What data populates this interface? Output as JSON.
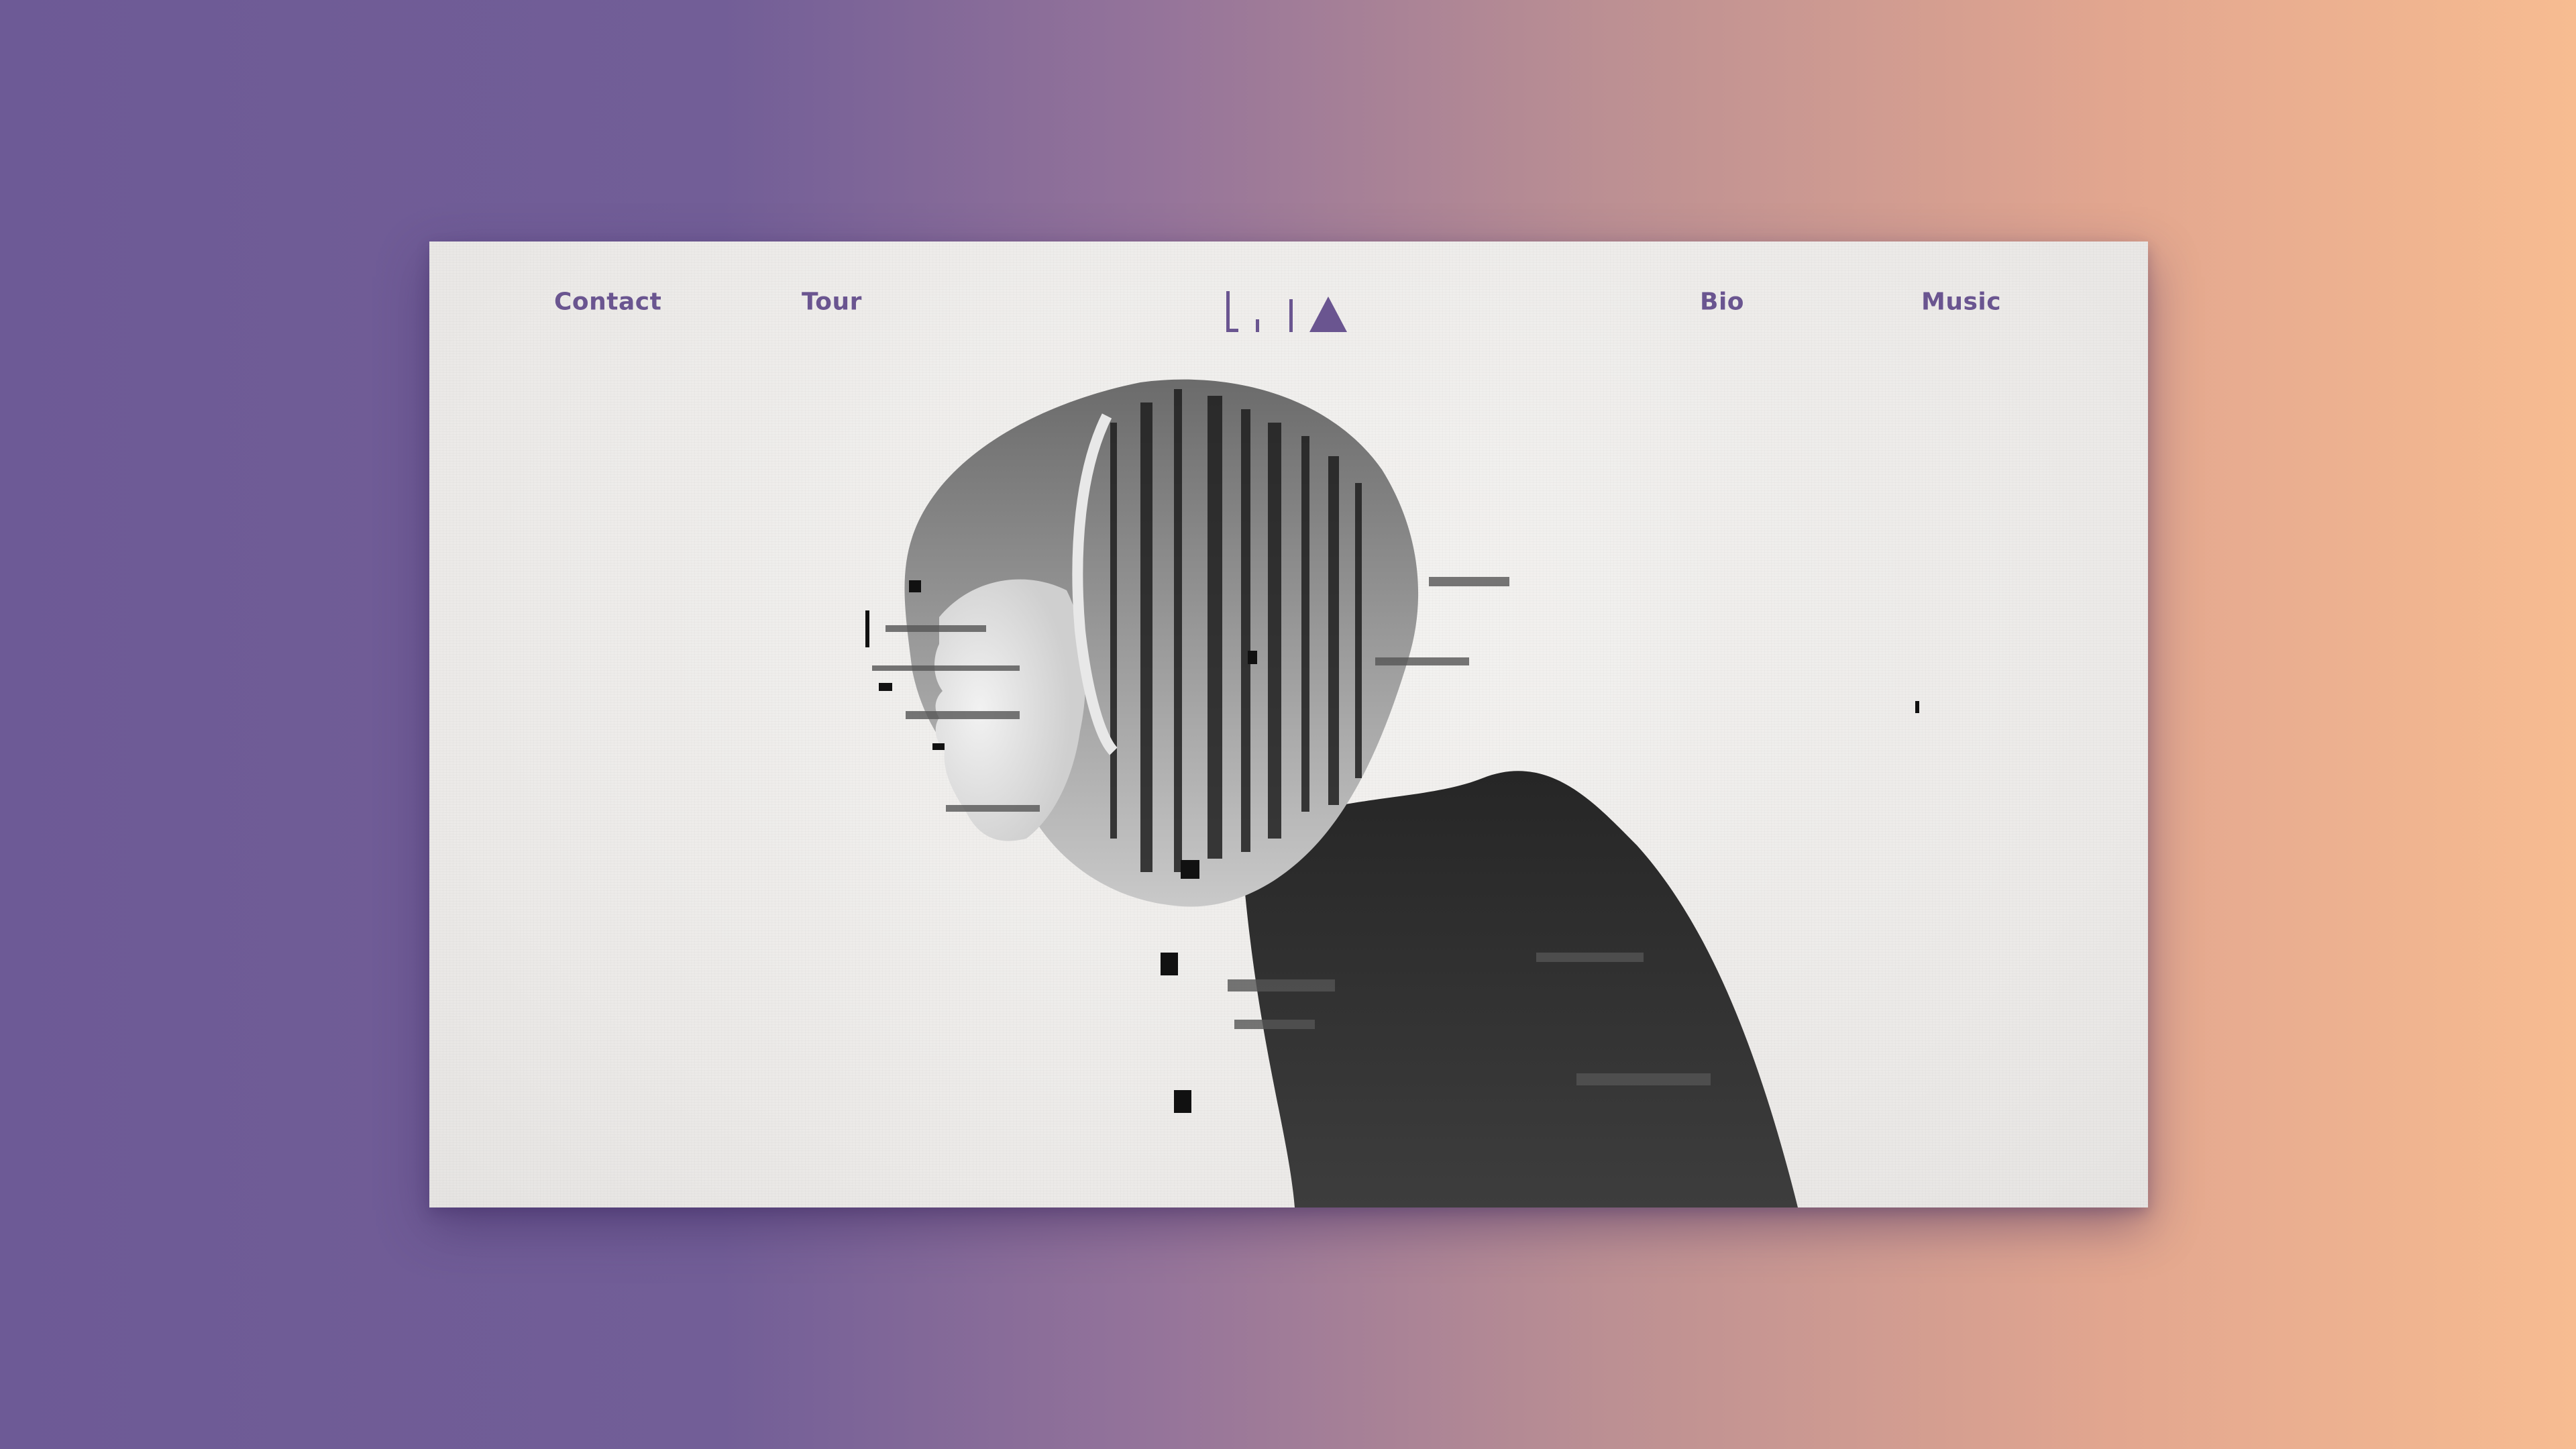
{
  "brand": {
    "logo_text": "LiIA",
    "logo_icon": "triangle-logo-icon"
  },
  "nav": {
    "left": [
      {
        "label": "Contact"
      },
      {
        "label": "Tour"
      }
    ],
    "right": [
      {
        "label": "Bio"
      },
      {
        "label": "Music"
      }
    ]
  },
  "colors": {
    "accent": "#6a5590",
    "card_background": "#efeeec",
    "gradient_left": "#6d5a96",
    "gradient_right": "#f7bc91"
  },
  "hero": {
    "image": "double-exposure-portrait-forest-glitch"
  }
}
